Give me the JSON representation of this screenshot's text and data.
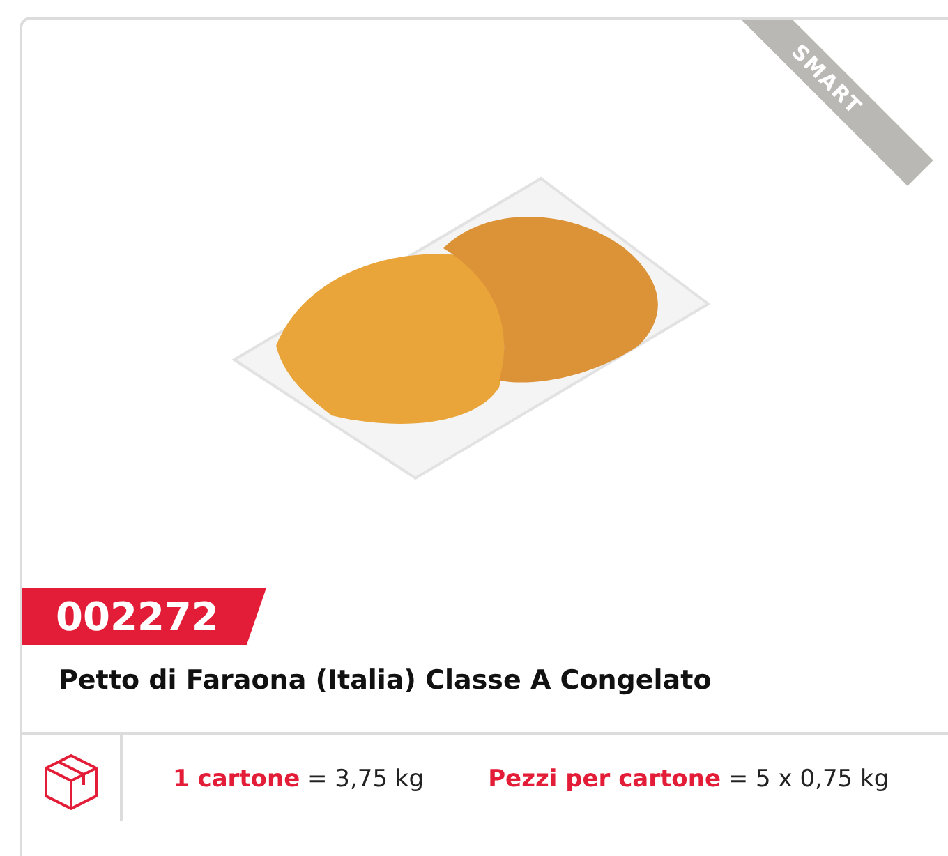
{
  "ribbon": {
    "label": "SMART"
  },
  "product": {
    "code": "002272",
    "name": "Petto di Faraona (Italia) Classe A Congelato"
  },
  "packaging": [
    {
      "text": "**1 cartone** = 3,75 kg"
    },
    {
      "text": "**Pezzi per cartone** = 5 x 0,75 kg"
    }
  ]
}
